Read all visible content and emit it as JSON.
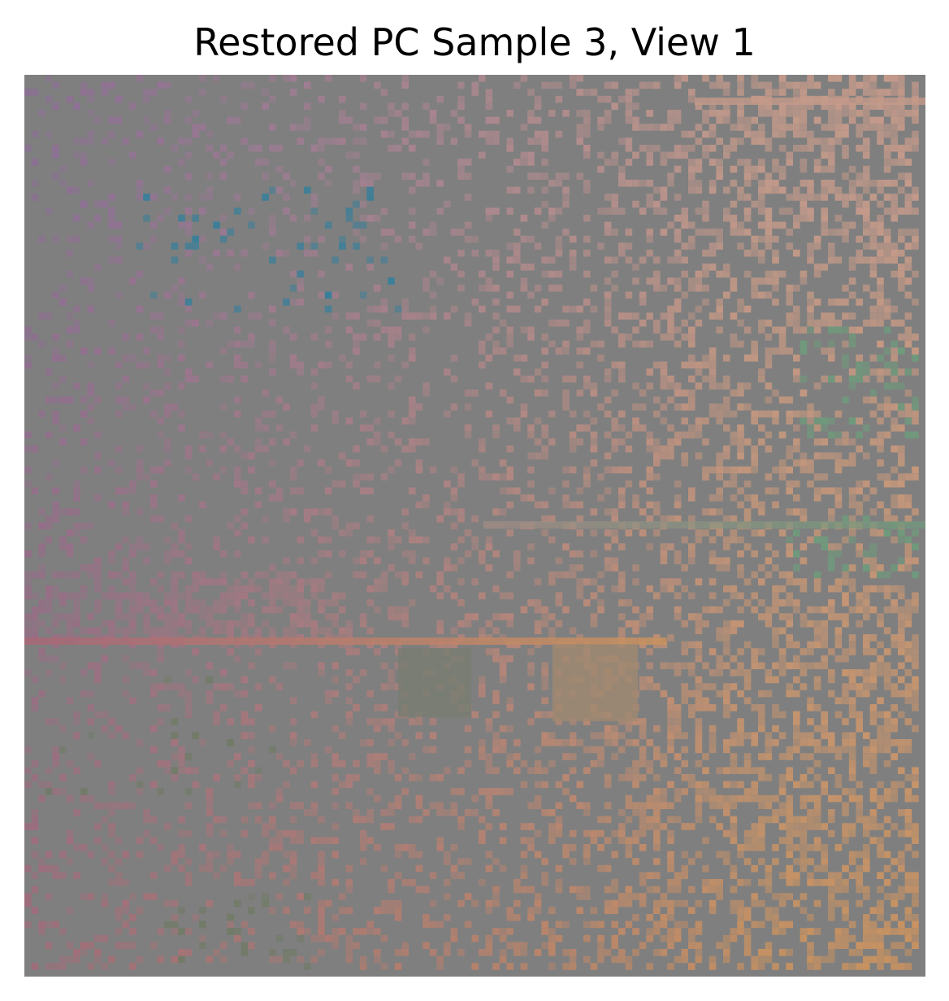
{
  "figure": {
    "title": "Restored PC Sample 3, View 1"
  },
  "image": {
    "background_color": "#7f7f7f",
    "palette": {
      "violet": "#8e6a9a",
      "blue": "#2e7f9e",
      "rose": "#a86878",
      "peach": "#c49a8a",
      "orange": "#c9925f",
      "green": "#6f9a7c",
      "olive": "#6f7a62"
    }
  }
}
